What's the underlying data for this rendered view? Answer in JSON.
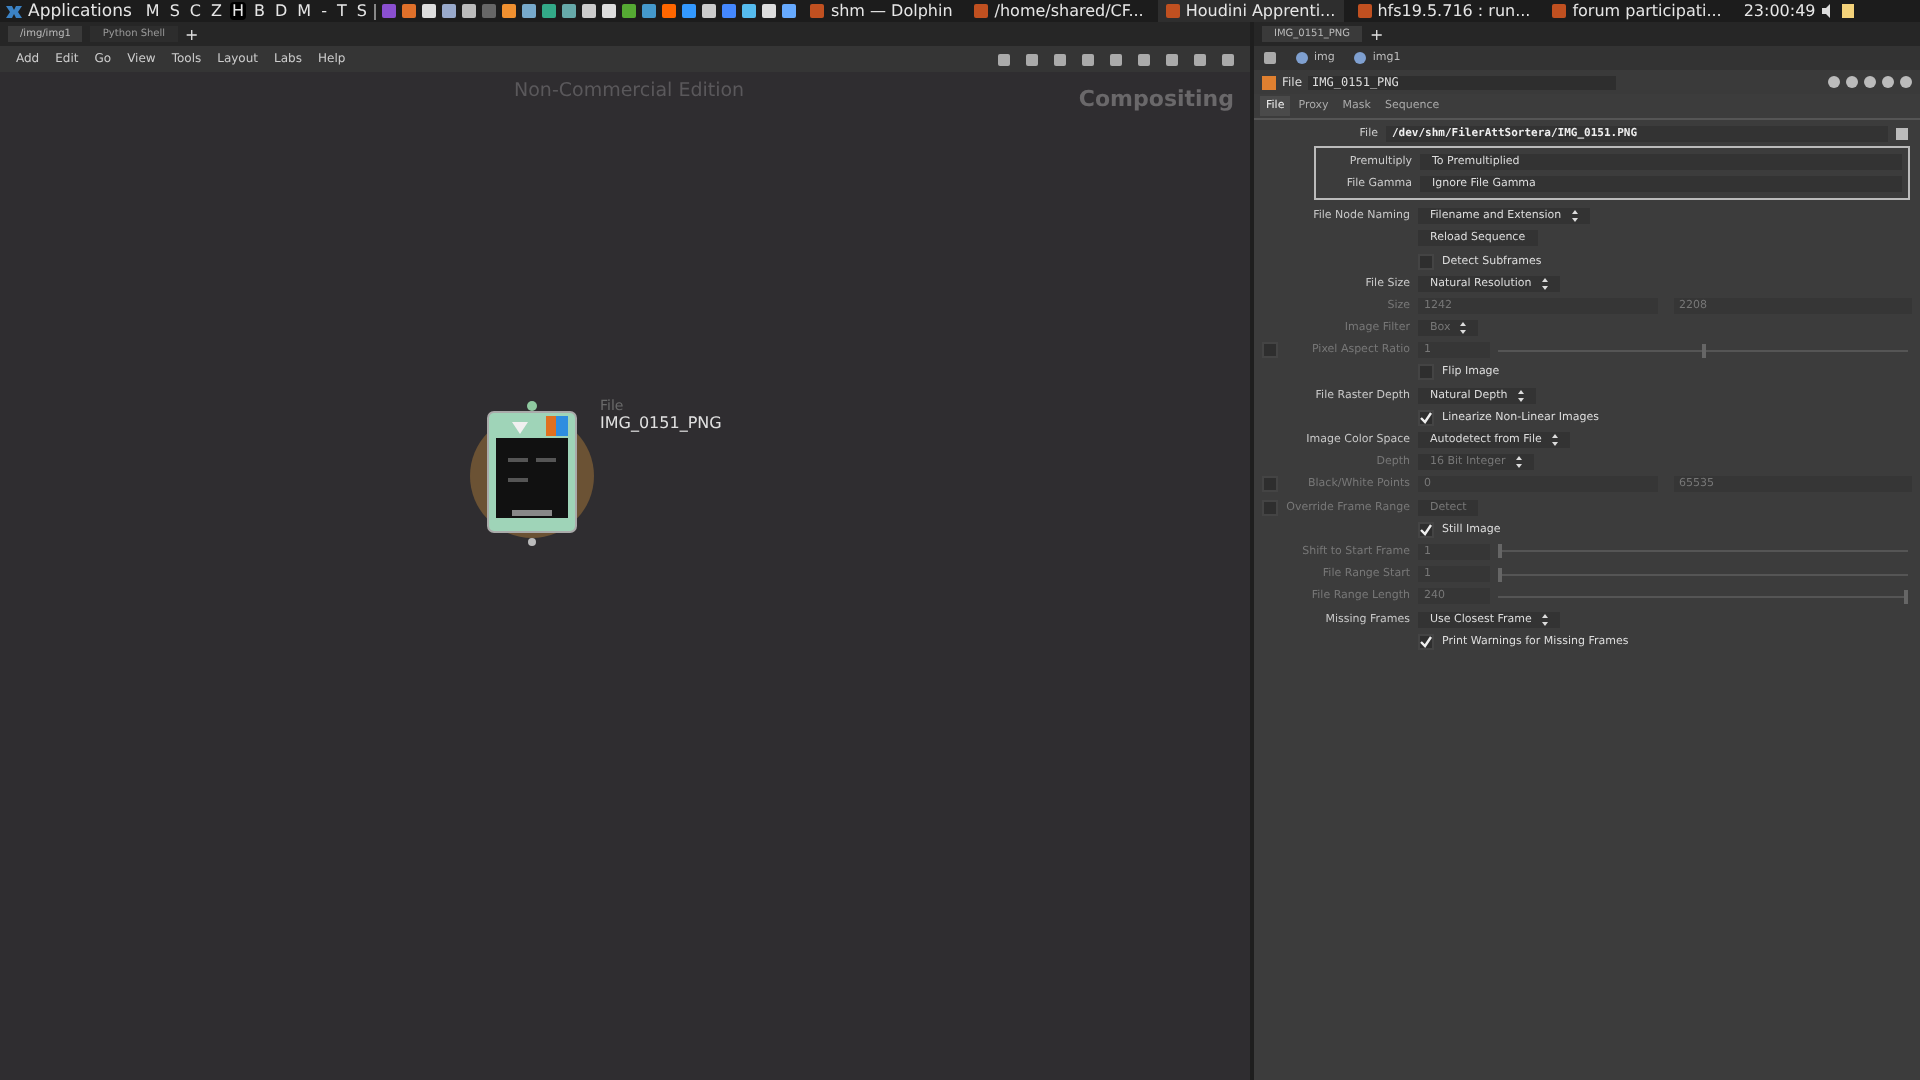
{
  "taskbar": {
    "menu": "Applications",
    "launchers": [
      {
        "label": "M",
        "selected": false
      },
      {
        "label": "S",
        "selected": false
      },
      {
        "label": "C",
        "selected": false
      },
      {
        "label": "Z",
        "selected": false
      },
      {
        "label": "H",
        "selected": true
      },
      {
        "label": "B",
        "selected": false
      },
      {
        "label": "D",
        "selected": false
      },
      {
        "label": "M",
        "selected": false
      },
      {
        "label": "-",
        "selected": false
      },
      {
        "label": "T",
        "selected": false
      },
      {
        "label": "S",
        "selected": false
      }
    ],
    "tasks": [
      {
        "label": "shm — Dolphin",
        "selected": false
      },
      {
        "label": "/home/shared/CF...",
        "selected": false
      },
      {
        "label": "Houdini Apprenti...",
        "selected": true
      },
      {
        "label": "hfs19.5.716 : run...",
        "selected": false
      },
      {
        "label": "forum participati...",
        "selected": false
      }
    ],
    "clock": "23:00:49"
  },
  "network": {
    "tabs": [
      {
        "label": "/img/img1",
        "selected": true
      },
      {
        "label": "Python Shell",
        "selected": false
      }
    ],
    "add_tab": "+",
    "menu": [
      "Add",
      "Edit",
      "Go",
      "View",
      "Tools",
      "Layout",
      "Labs",
      "Help"
    ],
    "edition": "Non-Commercial Edition",
    "context": "Compositing",
    "node": {
      "type": "File",
      "name": "IMG_0151_PNG"
    }
  },
  "parameters": {
    "tabs": [
      {
        "label": "IMG_0151_PNG",
        "selected": true
      }
    ],
    "add_tab": "+",
    "path": [
      "img",
      "img1"
    ],
    "node_type": "File",
    "node_name": "IMG_0151_PNG",
    "page_tabs": [
      {
        "label": "File",
        "selected": true
      },
      {
        "label": "Proxy",
        "selected": false
      },
      {
        "label": "Mask",
        "selected": false
      },
      {
        "label": "Sequence",
        "selected": false
      }
    ],
    "file": {
      "label": "File",
      "value": "/dev/shm/FilerAttSortera/IMG_0151.PNG"
    },
    "group": [
      {
        "label": "Premultiply",
        "value": "To Premultiplied"
      },
      {
        "label": "File Gamma",
        "value": "Ignore File Gamma"
      }
    ],
    "rows": [
      {
        "kind": "menu",
        "label": "File Node Naming",
        "value": "Filename and Extension",
        "disabled": false
      },
      {
        "kind": "button",
        "value": "Reload Sequence",
        "disabled": false
      },
      {
        "kind": "toggle",
        "value": "Detect Subframes",
        "checked": false,
        "disabled": false
      },
      {
        "kind": "menu",
        "label": "File Size",
        "value": "Natural Resolution",
        "disabled": false
      },
      {
        "kind": "vector",
        "label": "Size",
        "values": [
          "1242",
          "2208"
        ],
        "disabled": true
      },
      {
        "kind": "menu",
        "label": "Image Filter",
        "value": "Box",
        "disabled": true
      },
      {
        "kind": "slider",
        "label": "Pixel Aspect Ratio",
        "value": "1",
        "level": 0.5,
        "enable_box": true,
        "enable_checked": false,
        "disabled": true
      },
      {
        "kind": "toggle",
        "value": "Flip Image",
        "checked": false,
        "disabled": false
      },
      {
        "kind": "menu",
        "label": "File Raster Depth",
        "value": "Natural Depth",
        "disabled": false
      },
      {
        "kind": "toggle",
        "value": "Linearize Non-Linear Images",
        "checked": true,
        "disabled": false
      },
      {
        "kind": "menu",
        "label": "Image Color Space",
        "value": "Autodetect from File",
        "disabled": false
      },
      {
        "kind": "menu",
        "label": "Depth",
        "value": "16 Bit Integer",
        "disabled": true
      },
      {
        "kind": "vector",
        "label": "Black/White Points",
        "values": [
          "0",
          "65535"
        ],
        "enable_box": true,
        "enable_checked": false,
        "disabled": true
      },
      {
        "kind": "button",
        "label": "Override Frame Range",
        "value": "Detect",
        "enable_box": true,
        "enable_checked": false,
        "disabled": true
      },
      {
        "kind": "toggle",
        "value": "Still Image",
        "checked": true,
        "disabled": false
      },
      {
        "kind": "slider",
        "label": "Shift to Start Frame",
        "value": "1",
        "level": 0,
        "disabled": true
      },
      {
        "kind": "slider",
        "label": "File Range Start",
        "value": "1",
        "level": 0,
        "disabled": true
      },
      {
        "kind": "slider",
        "label": "File Range Length",
        "value": "240",
        "level": 1,
        "disabled": true
      },
      {
        "kind": "menu",
        "label": "Missing Frames",
        "value": "Use Closest Frame",
        "disabled": false
      },
      {
        "kind": "toggle",
        "value": "Print Warnings for Missing Frames",
        "checked": true,
        "disabled": false
      }
    ]
  }
}
